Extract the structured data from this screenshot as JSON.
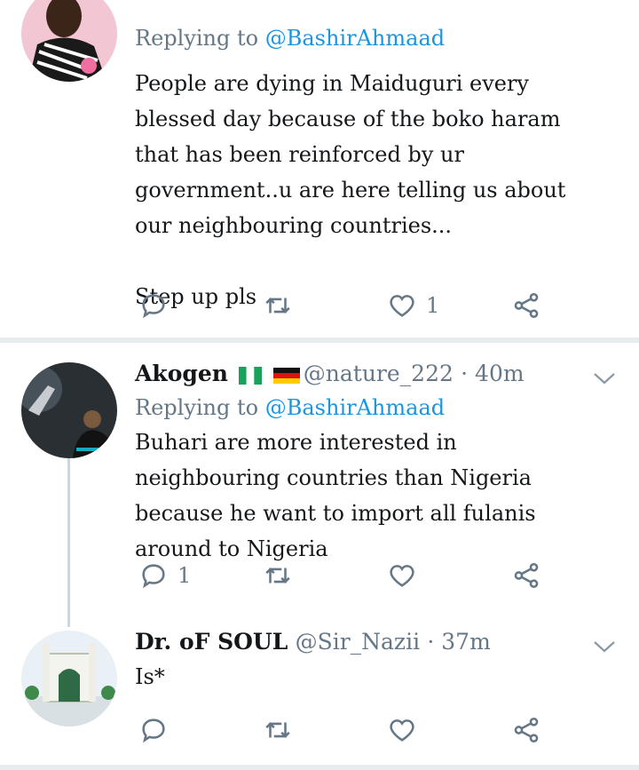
{
  "tweets": [
    {
      "replying_to_label": "Replying to",
      "replying_to_handle": "@BashirAhmaad",
      "text_lines": [
        "People are dying in Maiduguri every blessed day because of the boko haram that has been reinforced by ur government..u are here telling us about our neighbouring countries..."
      ],
      "text_tail": "Step up pls",
      "actions": {
        "reply_count": "",
        "retweet_count": "",
        "like_count": "1"
      }
    },
    {
      "name": "Akogen",
      "flags": [
        "nigeria-flag",
        "germany-flag"
      ],
      "handle": "@nature_222",
      "time": "· 40m",
      "replying_to_label": "Replying to",
      "replying_to_handle": "@BashirAhmaad",
      "text": "Buhari are more interested in neighbouring countries than Nigeria  because he want to import all fulanis around to Nigeria",
      "actions": {
        "reply_count": "1",
        "retweet_count": "",
        "like_count": ""
      }
    },
    {
      "name": "Dr. oF SOUL",
      "handle": "@Sir_Nazii",
      "time": "· 37m",
      "text": "Is*",
      "actions": {
        "reply_count": "",
        "retweet_count": "",
        "like_count": ""
      }
    }
  ],
  "colors": {
    "secondary": "#657786",
    "link": "#1b95e0",
    "divider": "#e6ecf0"
  },
  "icons": [
    "reply-icon",
    "retweet-icon",
    "like-icon",
    "share-icon",
    "chevron-down-icon"
  ]
}
